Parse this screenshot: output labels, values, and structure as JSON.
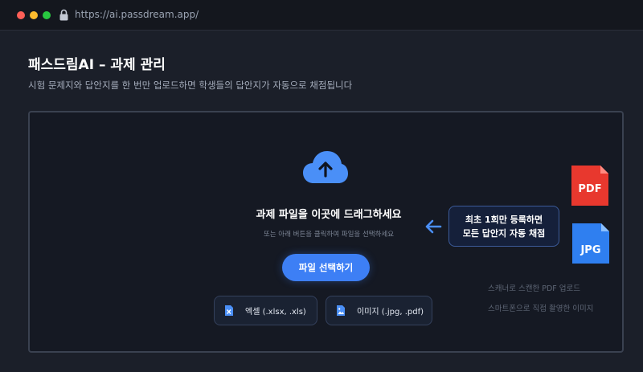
{
  "browser": {
    "url": "https://ai.passdream.app/"
  },
  "page": {
    "title": "패스드림AI – 과제 관리",
    "subtitle": "시험 문제지와 답안지를 한 번만 업로드하면 학생들의 답안지가 자동으로 채점됩니다"
  },
  "upload": {
    "title": "과제 파일을 이곳에 드래그하세요",
    "hint": "또는 아래 버튼을 클릭하여 파일을 선택하세요",
    "button_label": "파일 선택하기",
    "formats": [
      {
        "label": "엑셀 (.xlsx, .xls)"
      },
      {
        "label": "이미지 (.jpg, .pdf)"
      }
    ]
  },
  "callout": {
    "line1": "최초 1회만 등록하면",
    "line2": "모든 답안지 자동 채점"
  },
  "badges": {
    "pdf": "PDF",
    "jpg": "JPG"
  },
  "notes": [
    "스캐너로 스캔한 PDF 업로드",
    "스마트폰으로 직접 촬영한 이미지"
  ],
  "colors": {
    "accent": "#3d7ff5",
    "pdf_badge": "#e8382e",
    "jpg_badge": "#2f7ff0",
    "background": "#1b1f29"
  },
  "icons": [
    "lock-icon",
    "cloud-upload-icon",
    "excel-file-icon",
    "image-file-icon",
    "arrow-left-icon",
    "pdf-file-icon",
    "jpg-file-icon"
  ]
}
